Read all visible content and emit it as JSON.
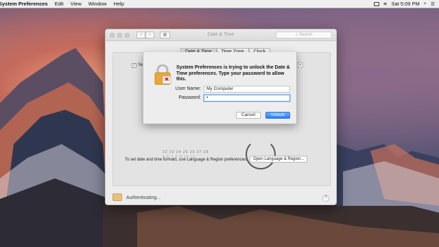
{
  "menubar": {
    "app_name": "System Preferences",
    "items": [
      "Edit",
      "View",
      "Window",
      "Help"
    ],
    "clock": "Sat 5:09 PM"
  },
  "window": {
    "title": "Date & Time",
    "search_placeholder": "Search",
    "tabs": [
      "Date & Time",
      "Time Zone",
      "Clock"
    ],
    "active_tab": "Date & Time",
    "checkbox_label_partial": "Se",
    "calendar_row": "22 23 24 25 26 27 28",
    "calendar_row_next": "5 6 7 8 9 10 11",
    "formats_text": "To set date and time formats, use Language & Region preferences.",
    "lang_button": "Open Language & Region...",
    "status_text": "Authenticating...",
    "help_glyph": "?"
  },
  "auth_dialog": {
    "message": "System Preferences is trying to unlock the Date & Time preferences. Type your password to allow this.",
    "username_label": "User Name:",
    "username_value": "My Computer",
    "password_label": "Password:",
    "password_value": "•",
    "cancel_label": "Cancel",
    "unlock_label": "Unlock"
  },
  "colors": {
    "accent": "#2a80f5",
    "focus_ring": "#6fa6ec"
  }
}
